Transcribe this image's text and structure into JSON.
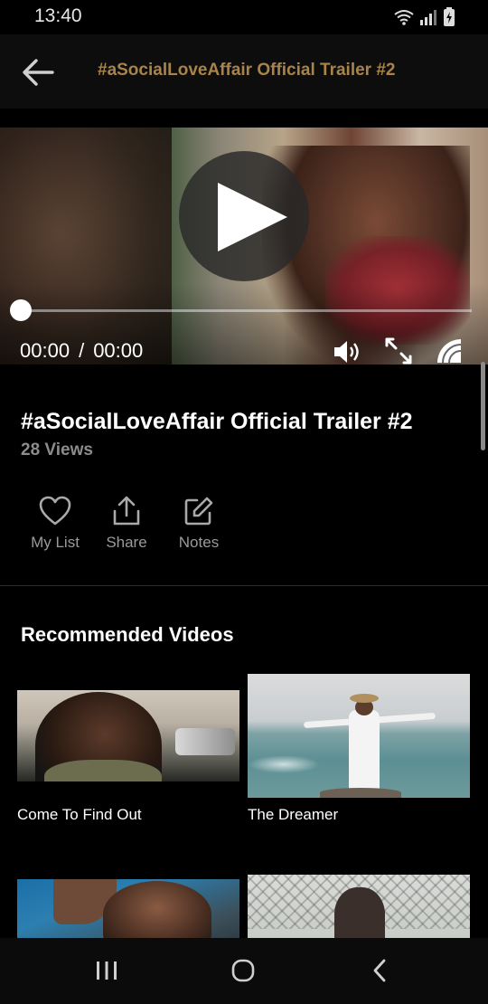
{
  "status_bar": {
    "time": "13:40",
    "icons": [
      "wifi-icon",
      "signal-icon",
      "battery-charging-icon"
    ]
  },
  "app_bar": {
    "back_icon": "arrow-left-icon",
    "title": "#aSocialLoveAffair Official Trailer #2",
    "title_color": "#a8834b"
  },
  "player": {
    "play_icon": "play-icon",
    "current_time": "00:00",
    "separator": "/",
    "duration": "00:00",
    "progress": 0,
    "controls": [
      "volume-icon",
      "fullscreen-icon",
      "cast-icon"
    ]
  },
  "video": {
    "title": "#aSocialLoveAffair Official Trailer #2",
    "views": "28 Views"
  },
  "actions": [
    {
      "label": "My List",
      "icon": "heart-icon"
    },
    {
      "label": "Share",
      "icon": "share-icon"
    },
    {
      "label": "Notes",
      "icon": "edit-icon"
    }
  ],
  "recommended": {
    "heading": "Recommended Videos",
    "items": [
      {
        "title": "Come To Find Out"
      },
      {
        "title": "The Dreamer"
      },
      {
        "title": ""
      },
      {
        "title": ""
      }
    ]
  },
  "nav_bar": {
    "icons": [
      "recents-icon",
      "home-icon",
      "back-icon"
    ]
  },
  "colors": {
    "background": "#000000",
    "app_bar": "#0d0d0d",
    "accent": "#a8834b",
    "muted_text": "#8c8c8c"
  }
}
